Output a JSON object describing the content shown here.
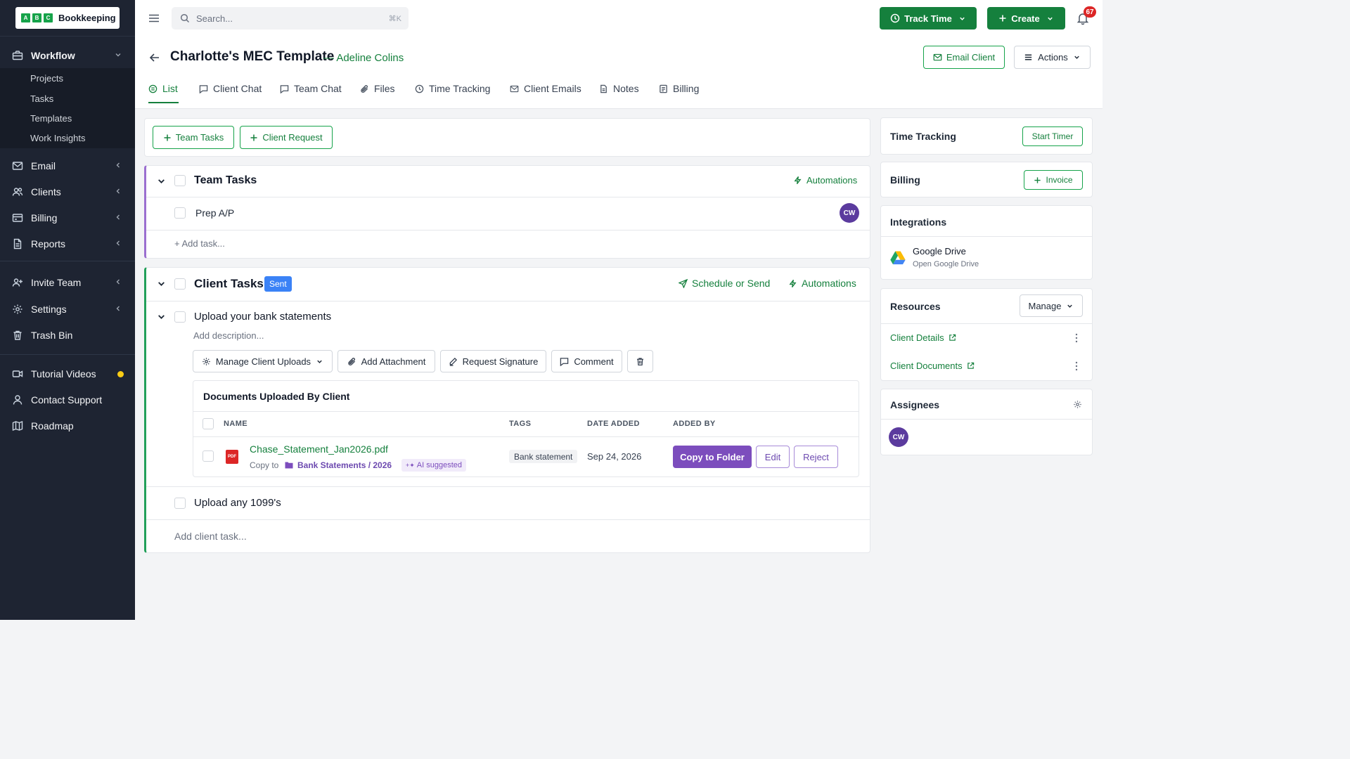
{
  "sidebar": {
    "logo": {
      "letters": [
        "A",
        "B",
        "C"
      ],
      "name": "Bookkeeping"
    },
    "workflow": {
      "label": "Workflow",
      "items": [
        "Projects",
        "Tasks",
        "Templates",
        "Work Insights"
      ]
    },
    "email": "Email",
    "clients": "Clients",
    "billing": "Billing",
    "reports": "Reports",
    "invite_team": "Invite Team",
    "settings": "Settings",
    "trash_bin": "Trash Bin",
    "tutorial_videos": "Tutorial Videos",
    "contact_support": "Contact Support",
    "roadmap": "Roadmap"
  },
  "header": {
    "search_placeholder": "Search...",
    "search_shortcut": "⌘K",
    "track_time": "Track Time",
    "create": "Create",
    "notification_count": "67",
    "title": "Charlotte's MEC Template",
    "client": "— Adeline Colins",
    "email_client": "Email Client",
    "actions": "Actions"
  },
  "tabs": [
    "List",
    "Client Chat",
    "Team Chat",
    "Files",
    "Time Tracking",
    "Client Emails",
    "Notes",
    "Billing"
  ],
  "add_buttons": {
    "team_tasks": "Team Tasks",
    "client_request": "Client Request"
  },
  "team_tasks": {
    "title": "Team Tasks",
    "automations": "Automations",
    "tasks": [
      {
        "name": "Prep A/P",
        "assignee": "CW"
      }
    ],
    "add_task": "+ Add task..."
  },
  "client_tasks": {
    "title": "Client Tasks",
    "status": "Sent",
    "schedule": "Schedule or Send",
    "automations": "Automations",
    "task1": {
      "title": "Upload your bank statements",
      "description_placeholder": "Add description...",
      "actions": {
        "manage_uploads": "Manage Client Uploads",
        "add_attachment": "Add Attachment",
        "request_signature": "Request Signature",
        "comment": "Comment"
      },
      "docs": {
        "title": "Documents Uploaded By Client",
        "columns": [
          "NAME",
          "TAGS",
          "DATE ADDED",
          "ADDED BY"
        ],
        "rows": [
          {
            "file_type": "PDF",
            "name": "Chase_Statement_Jan2026.pdf",
            "copy_to_label": "Copy to",
            "folder": "Bank Statements / 2026",
            "ai_label": "AI suggested",
            "tag": "Bank statement",
            "date": "Sep 24, 2026",
            "copy_button": "Copy to Folder",
            "edit": "Edit",
            "reject": "Reject"
          }
        ]
      }
    },
    "task2": {
      "title": "Upload any 1099's"
    },
    "add_client_task": "Add client task..."
  },
  "right_panel": {
    "time_tracking": {
      "title": "Time Tracking",
      "button": "Start Timer"
    },
    "billing": {
      "title": "Billing",
      "button": "Invoice"
    },
    "integrations": {
      "title": "Integrations",
      "item_name": "Google Drive",
      "item_sub": "Open Google Drive"
    },
    "resources": {
      "title": "Resources",
      "manage": "Manage",
      "links": [
        "Client Details",
        "Client Documents"
      ]
    },
    "assignees": {
      "title": "Assignees",
      "users": [
        "CW"
      ]
    }
  },
  "colors": {
    "sidebar": "#1e2432",
    "accent": "#15803d",
    "purple": "#7c4dbd",
    "status_badge": "#3b82f6",
    "notification": "#dc2626"
  }
}
